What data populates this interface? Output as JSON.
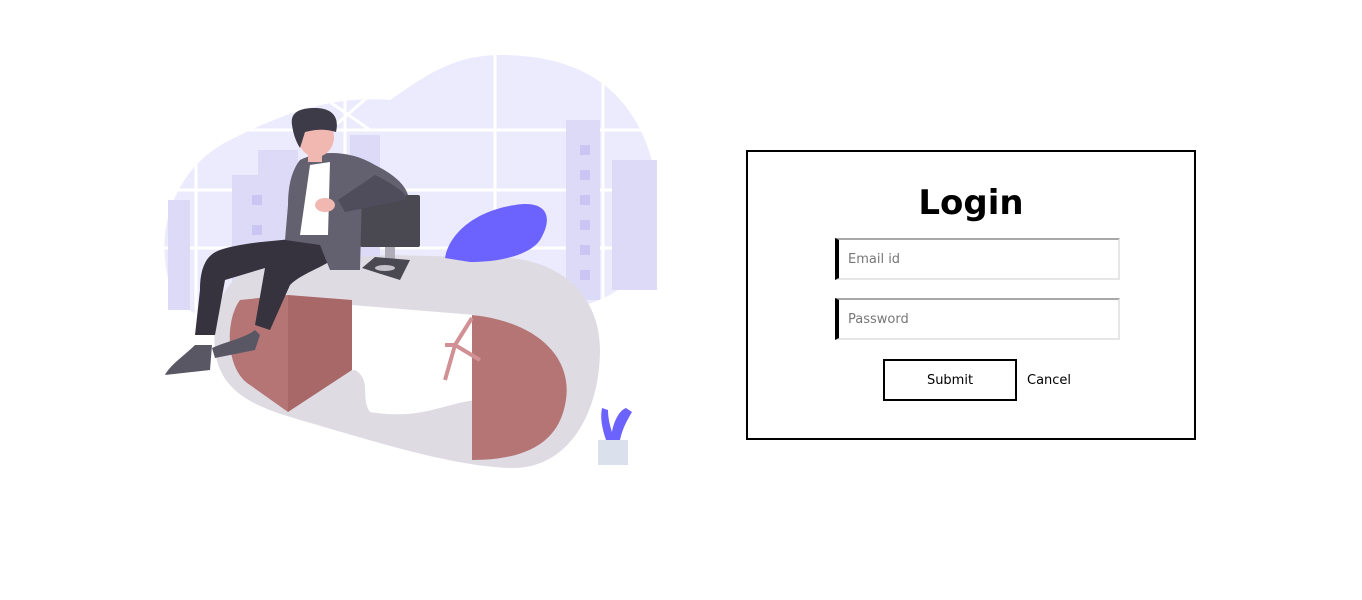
{
  "login": {
    "title": "Login",
    "email_placeholder": "Email id",
    "password_placeholder": "Password",
    "submit_label": "Submit",
    "cancel_label": "Cancel"
  },
  "illustration": {
    "name": "person-sitting-on-desk-illustration",
    "colors": {
      "blob": "#ecebfd",
      "buildings": "#dcdaf7",
      "desk": "#dedbe3",
      "desk_side": "#b57575",
      "chair": "#6c63ff",
      "monitor": "#4a4850",
      "jacket": "#636070",
      "pants": "#36333f",
      "skin": "#f0b8b1",
      "hair": "#3d3b47",
      "plant": "#6c63ff",
      "pot": "#dbe1ec"
    }
  }
}
